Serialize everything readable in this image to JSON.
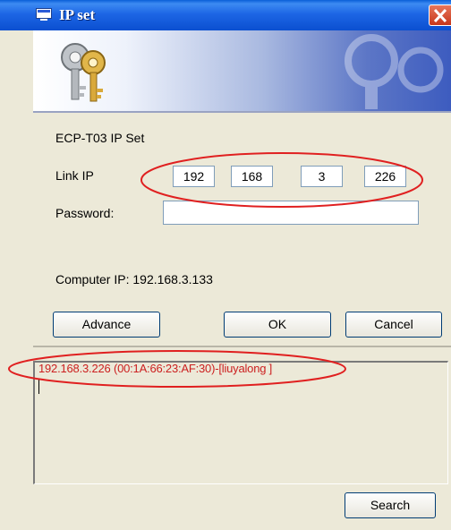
{
  "window": {
    "title": "IP set",
    "close_icon": "close-icon",
    "title_icon": "window-icon",
    "banner_icon": "keys-icon"
  },
  "form": {
    "heading": "ECP-T03 IP Set",
    "link_ip_label": "Link IP",
    "ip_octets": [
      "192",
      "168",
      "3",
      "226"
    ],
    "password_label": "Password:",
    "password_value": "",
    "computer_ip": "Computer IP: 192.168.3.133"
  },
  "buttons": {
    "advance": "Advance",
    "ok": "OK",
    "cancel": "Cancel",
    "search": "Search"
  },
  "results": {
    "found_device": "192.168.3.226 (00:1A:66:23:AF:30)-[liuyalong ]"
  },
  "colors": {
    "titlebar": "#0B4FD0",
    "window_bg": "#ECE9D8",
    "highlight": "#E02020",
    "result_text": "#CC2020"
  }
}
